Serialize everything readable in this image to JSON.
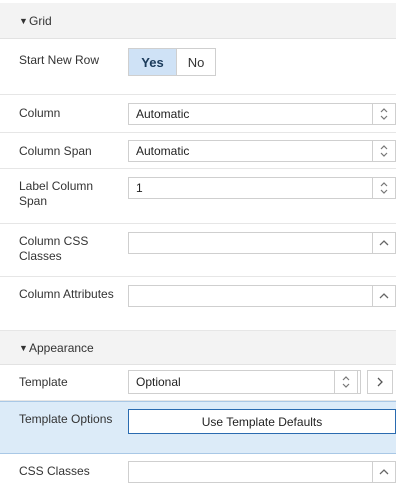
{
  "sections": {
    "grid": {
      "title": "Grid"
    },
    "appearance": {
      "title": "Appearance"
    }
  },
  "fields": {
    "start_new_row": {
      "label": "Start New Row",
      "options": [
        "Yes",
        "No"
      ],
      "selected": "Yes"
    },
    "column": {
      "label": "Column",
      "value": "Automatic"
    },
    "column_span": {
      "label": "Column Span",
      "value": "Automatic"
    },
    "label_column_span": {
      "label": "Label Column Span",
      "value": "1"
    },
    "column_css_classes": {
      "label": "Column CSS Classes",
      "value": ""
    },
    "column_attributes": {
      "label": "Column Attributes",
      "value": ""
    },
    "template": {
      "label": "Template",
      "value": "Optional"
    },
    "template_options": {
      "label": "Template Options",
      "button": "Use Template Defaults"
    },
    "css_classes": {
      "label": "CSS Classes",
      "value": ""
    }
  },
  "colors": {
    "header_bg": "#f3f3f3",
    "selected_bg": "#cfe2f6",
    "highlight_row": "#dcebf8",
    "focus_border": "#2a6bb0",
    "marker": "#d61a1a"
  },
  "icons": [
    "collapse-caret-icon",
    "spinner-up-down-icon",
    "chevron-up-icon",
    "chevron-right-icon"
  ]
}
